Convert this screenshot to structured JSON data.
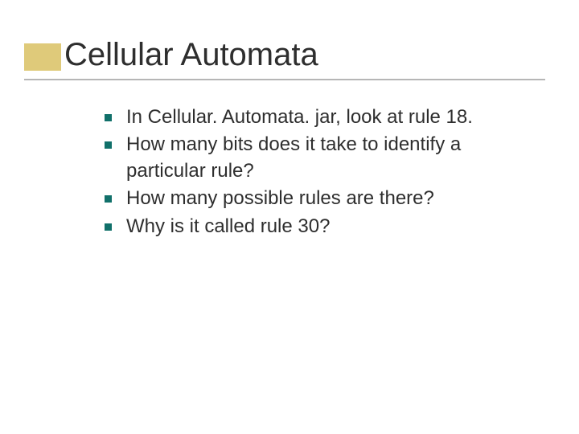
{
  "slide": {
    "title": "Cellular Automata",
    "bullets": [
      "In Cellular. Automata. jar, look at rule 18.",
      "How many bits does it take to identify a particular rule?",
      "How many possible rules are there?",
      "Why is it called rule 30?"
    ]
  }
}
